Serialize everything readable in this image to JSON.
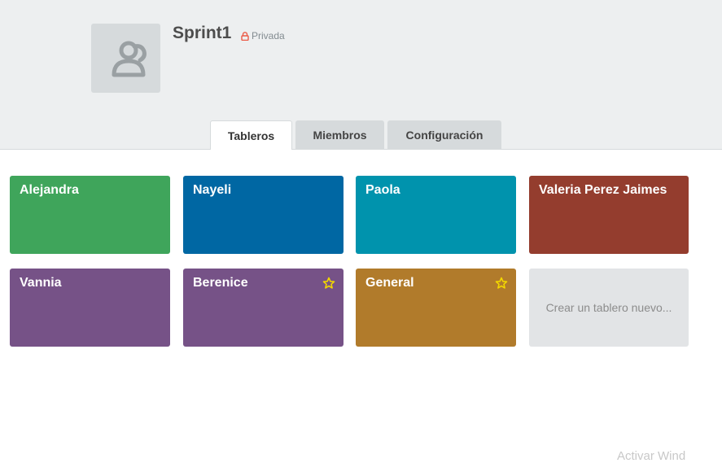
{
  "team": {
    "name": "Sprint1",
    "privacy_label": "Privada",
    "avatar_icon": "team-members-icon",
    "privacy_icon": "lock-icon",
    "privacy_color": "#eb5a46"
  },
  "tabs": [
    {
      "label": "Tableros",
      "active": true
    },
    {
      "label": "Miembros",
      "active": false
    },
    {
      "label": "Configuración",
      "active": false
    }
  ],
  "boards": [
    {
      "title": "Alejandra",
      "color": "#3fa55b",
      "starred": false
    },
    {
      "title": "Nayeli",
      "color": "#0067a3",
      "starred": false
    },
    {
      "title": "Paola",
      "color": "#0093ad",
      "starred": false
    },
    {
      "title": "Valeria Perez Jaimes",
      "color": "#943d2e",
      "starred": false
    },
    {
      "title": "Vannia",
      "color": "#765287",
      "starred": false
    },
    {
      "title": "Berenice",
      "color": "#765287",
      "starred": true
    },
    {
      "title": "General",
      "color": "#b17b2b",
      "starred": true
    }
  ],
  "create_board_label": "Crear un tablero nuevo...",
  "star_color": "#f2d600",
  "watermark_text": "Activar Wind"
}
